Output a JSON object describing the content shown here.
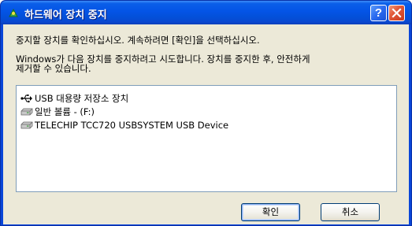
{
  "window": {
    "title": "하드웨어 장치 중지",
    "help_glyph": "?",
    "close_glyph": "✕"
  },
  "message": {
    "line1": "중지할 장치를 확인하십시오. 계속하려면 [확인]을 선택하십시오.",
    "line2": "Windows가 다음 장치를 중지하려고 시도합니다. 장치를 중지한 후, 안전하게",
    "line3": "제거할 수 있습니다."
  },
  "devices": [
    {
      "label": "USB 대용량 저장소 장치",
      "icon": "usb-icon",
      "selected": true
    },
    {
      "label": "일반 볼륨 - (F:)",
      "icon": "drive-icon",
      "selected": false
    },
    {
      "label": "TELECHIP TCC720 USBSYSTEM USB Device",
      "icon": "drive-icon",
      "selected": false
    }
  ],
  "buttons": {
    "ok_label": "확인",
    "cancel_label": "취소"
  },
  "colors": {
    "titlebar": "#0454e6",
    "client": "#ece9d8",
    "close": "#e25a3a"
  }
}
